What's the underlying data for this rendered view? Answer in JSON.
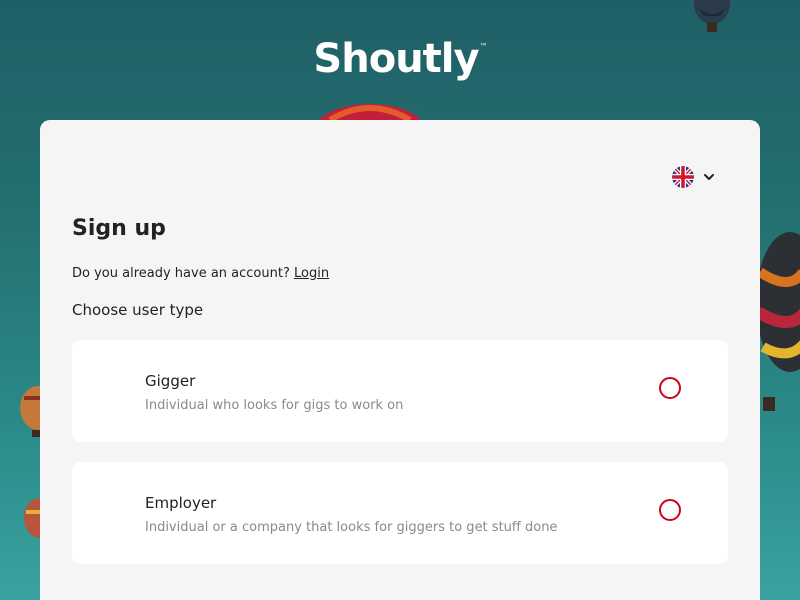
{
  "brand": {
    "logo_text": "Shoutly",
    "trademark": "™"
  },
  "language": {
    "flag": "uk-flag-icon",
    "dropdown_icon": "chevron-down-icon"
  },
  "signup": {
    "title": "Sign up",
    "account_question": "Do you already have an account?",
    "login_link": "Login",
    "choose_label": "Choose user type",
    "options": [
      {
        "title": "Gigger",
        "description": "Individual who looks for gigs to work on",
        "selected": false
      },
      {
        "title": "Employer",
        "description": "Individual or a company that looks for giggers to get stuff done",
        "selected": false
      }
    ]
  },
  "colors": {
    "accent": "#d0021b",
    "card": "#f5f5f5",
    "background": "#23706f"
  }
}
